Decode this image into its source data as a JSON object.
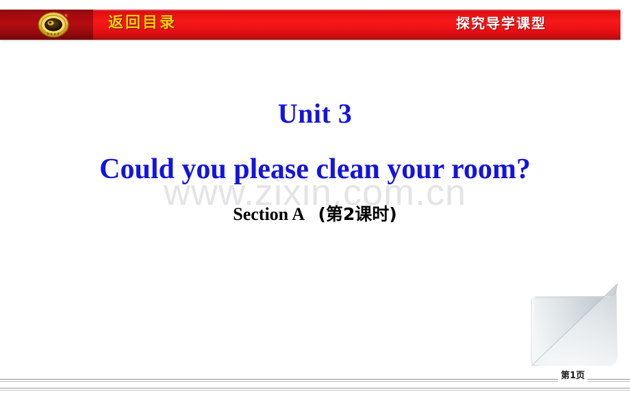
{
  "slide": {
    "background_color": "#ffffff",
    "watermark_text": "www.zixin.com.cn"
  },
  "header": {
    "banner_color": "#ef1214",
    "left_block_color": "#a60c10",
    "logo_icon": "circular-gold-emblem-logo",
    "return_label": "返回目录",
    "return_label_color": "#ffd200",
    "course_type_label": "探究导学课型",
    "course_type_label_color": "#ffffff"
  },
  "title": {
    "unit": "Unit 3",
    "main": "Could you please clean your room?",
    "section_en": "Section A",
    "section_cn": "(第2课时)",
    "title_color": "#1414e0",
    "section_color": "#000000"
  },
  "decoration": {
    "page_curl_icon": "folded-page-corner-icon"
  },
  "footer": {
    "page_number": "第1页"
  }
}
